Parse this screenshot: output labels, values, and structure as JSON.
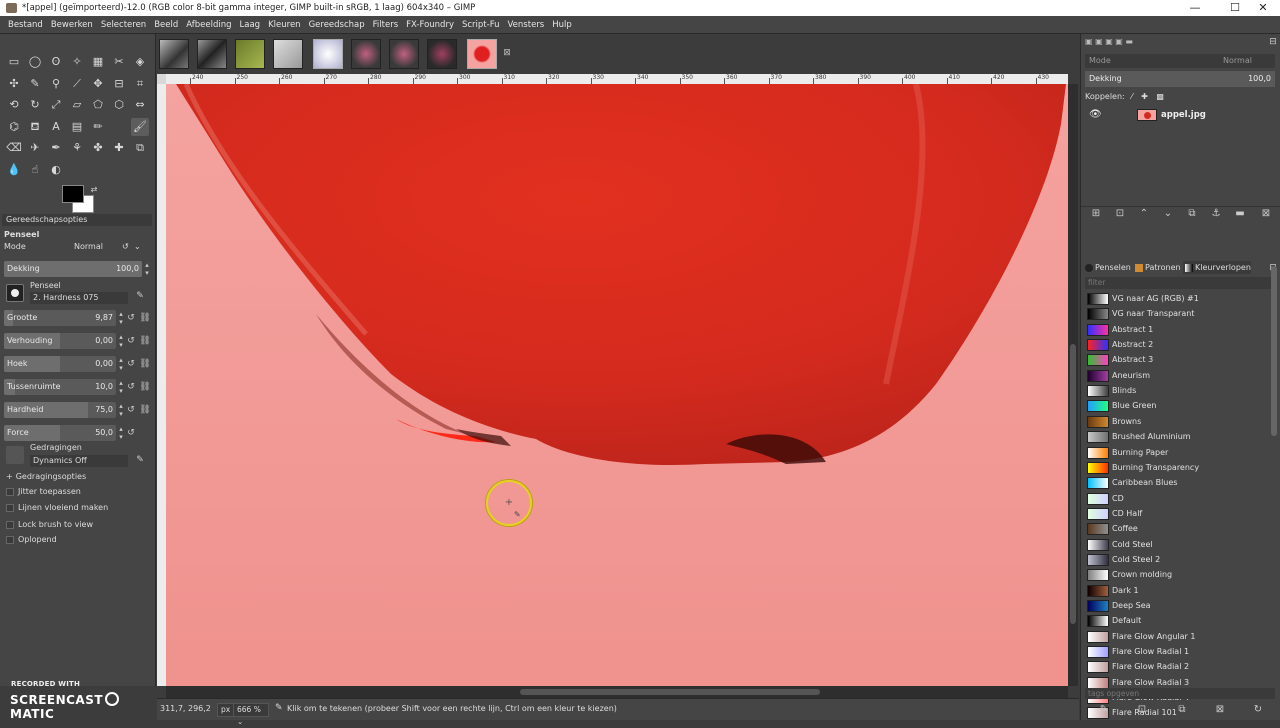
{
  "window": {
    "title": "*[appel] (geïmporteerd)-12.0 (RGB color 8-bit gamma integer, GIMP built-in sRGB, 1 laag) 604x340 – GIMP",
    "minimize": "—",
    "maximize": "☐",
    "close": "✕"
  },
  "menu": [
    "Bestand",
    "Bewerken",
    "Selecteren",
    "Beeld",
    "Afbeelding",
    "Laag",
    "Kleuren",
    "Gereedschap",
    "Filters",
    "FX-Foundry",
    "Script-Fu",
    "Vensters",
    "Hulp"
  ],
  "toolbox": {
    "tool_options_title": "Gereedschapsopties",
    "tool_name": "Penseel",
    "mode_label": "Mode",
    "mode_value": "Normal",
    "opacity_label": "Dekking",
    "opacity_value": "100,0",
    "brush_label": "Penseel",
    "brush_value": "2. Hardness 075",
    "sliders": [
      {
        "label": "Grootte",
        "value": "9,87",
        "fill": 0.08
      },
      {
        "label": "Verhouding",
        "value": "0,00",
        "fill": 0.5
      },
      {
        "label": "Hoek",
        "value": "0,00",
        "fill": 0.5
      },
      {
        "label": "Tussenruimte",
        "value": "10,0",
        "fill": 0.1
      },
      {
        "label": "Hardheid",
        "value": "75,0",
        "fill": 0.75
      },
      {
        "label": "Force",
        "value": "50,0",
        "fill": 0.5
      }
    ],
    "dynamics_label": "Gedragingen",
    "dynamics_value": "Dynamics Off",
    "dynamics_options": "Gedragingsopties",
    "checks": [
      "Jitter toepassen",
      "Lijnen vloeiend maken",
      "Lock brush to view",
      "Oplopend"
    ]
  },
  "ruler": {
    "ticks": [
      "240",
      "250",
      "260",
      "270",
      "280",
      "290",
      "300",
      "310",
      "320",
      "330",
      "340",
      "350",
      "360",
      "370",
      "380",
      "390",
      "400",
      "410",
      "420",
      "430"
    ]
  },
  "status": {
    "coords": "311,7, 296,2",
    "unit": "px",
    "zoom": "666 %",
    "message": "Klik om te tekenen (probeer Shift voor een rechte lijn, Ctrl om een kleur te kiezen)"
  },
  "layers": {
    "mode_label": "Mode",
    "mode_value": "Normal",
    "opacity_label": "Dekking",
    "opacity_value": "100,0",
    "lock_label": "Koppelen:",
    "layer_name": "appel.jpg"
  },
  "dock_tabs": [
    "Penselen",
    "Patronen",
    "Kleurverlopen"
  ],
  "gradients": {
    "filter_placeholder": "filter",
    "tags_placeholder": "tags opgeven",
    "items": [
      {
        "name": "VG naar AG (RGB) #1",
        "colors": [
          "#000000",
          "#ffffff"
        ]
      },
      {
        "name": "VG naar Transparant",
        "colors": [
          "#000000",
          "#888888"
        ]
      },
      {
        "name": "Abstract 1",
        "colors": [
          "#3030ff",
          "#ff30a0"
        ]
      },
      {
        "name": "Abstract 2",
        "colors": [
          "#ff2020",
          "#3030ff"
        ]
      },
      {
        "name": "Abstract 3",
        "colors": [
          "#30c030",
          "#ff40c0"
        ]
      },
      {
        "name": "Aneurism",
        "colors": [
          "#200030",
          "#a040a0"
        ]
      },
      {
        "name": "Blinds",
        "colors": [
          "#ffffff",
          "#404040"
        ]
      },
      {
        "name": "Blue Green",
        "colors": [
          "#20a0ff",
          "#20ff80"
        ]
      },
      {
        "name": "Browns",
        "colors": [
          "#6a3a10",
          "#d08a30"
        ]
      },
      {
        "name": "Brushed Aluminium",
        "colors": [
          "#c8c8c8",
          "#707070"
        ]
      },
      {
        "name": "Burning Paper",
        "colors": [
          "#ffffff",
          "#ff8000"
        ]
      },
      {
        "name": "Burning Transparency",
        "colors": [
          "#ffff00",
          "#ff3000"
        ]
      },
      {
        "name": "Caribbean Blues",
        "colors": [
          "#00c0ff",
          "#ffffff"
        ]
      },
      {
        "name": "CD",
        "colors": [
          "#e0ffe0",
          "#d0d0ff"
        ]
      },
      {
        "name": "CD Half",
        "colors": [
          "#e0ffe0",
          "#d0d0ff"
        ]
      },
      {
        "name": "Coffee",
        "colors": [
          "#5a3a20",
          "#909090"
        ]
      },
      {
        "name": "Cold Steel",
        "colors": [
          "#ffffff",
          "#404050"
        ]
      },
      {
        "name": "Cold Steel 2",
        "colors": [
          "#c0c0d0",
          "#303040"
        ]
      },
      {
        "name": "Crown molding",
        "colors": [
          "#808080",
          "#ffffff"
        ]
      },
      {
        "name": "Dark 1",
        "colors": [
          "#100000",
          "#a06040"
        ]
      },
      {
        "name": "Deep Sea",
        "colors": [
          "#000060",
          "#2080c0"
        ]
      },
      {
        "name": "Default",
        "colors": [
          "#000000",
          "#ffffff"
        ]
      },
      {
        "name": "Flare Glow Angular 1",
        "colors": [
          "#ffffff",
          "#c0a0a0"
        ]
      },
      {
        "name": "Flare Glow Radial 1",
        "colors": [
          "#ffffff",
          "#a0a0ff"
        ]
      },
      {
        "name": "Flare Glow Radial 2",
        "colors": [
          "#ffffff",
          "#c0a0a0"
        ]
      },
      {
        "name": "Flare Glow Radial 3",
        "colors": [
          "#ffffff",
          "#c08080"
        ]
      },
      {
        "name": "Flare Glow Radial 4",
        "colors": [
          "#ffffff",
          "#ff8080"
        ]
      },
      {
        "name": "Flare Radial 101",
        "colors": [
          "#ffffff",
          "#c0a0a0"
        ]
      }
    ]
  },
  "watermark": {
    "line1": "RECORDED WITH",
    "line2_a": "SCREENCAST",
    "line2_b": "MATIC"
  },
  "colors": {
    "canvas_bg": "#f4a3a0",
    "apple_red": "#d42a1e",
    "cursor_ring": "#e8d020"
  }
}
